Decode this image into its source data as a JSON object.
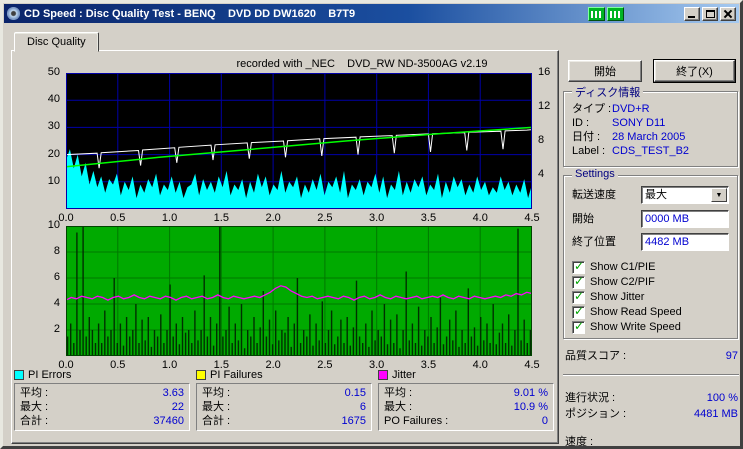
{
  "window": {
    "title": "CD Speed : Disc Quality Test - BENQ    DVD DD DW1620    B7T9"
  },
  "tab": {
    "label": "Disc Quality"
  },
  "chart_data": [
    {
      "type": "area",
      "title": "PI Errors / Read & Write Speed",
      "annotation": "recorded with _NEC    DVD_RW ND-3500AG v2.19",
      "xlabel": "",
      "ylabel": "",
      "x_range": [
        0,
        4.5
      ],
      "x_ticks": [
        "0.0",
        "0.5",
        "1.0",
        "1.5",
        "2.0",
        "2.5",
        "3.0",
        "3.5",
        "4.0",
        "4.5"
      ],
      "y_left": {
        "range": [
          0,
          50
        ],
        "ticks": [
          50,
          40,
          30,
          20,
          10
        ]
      },
      "y_right": {
        "range": [
          0,
          16
        ],
        "ticks": [
          16,
          12,
          8,
          4
        ]
      },
      "bg": "#000000",
      "grid": "#0000a8",
      "frame": "#0000a8",
      "series": [
        {
          "name": "PI Errors",
          "color": "#00ffff",
          "style": "area",
          "axis": "left",
          "values": [
            18,
            22,
            15,
            20,
            12,
            17,
            9,
            14,
            8,
            12,
            6,
            11,
            9,
            13,
            5,
            10,
            7,
            12,
            4,
            9,
            6,
            11,
            8,
            13,
            5,
            9,
            7,
            12,
            6,
            10,
            4,
            8,
            9,
            13,
            5,
            11,
            7,
            10,
            6,
            12,
            8,
            14,
            5,
            9,
            7,
            11,
            4,
            10,
            6,
            13,
            8,
            12,
            5,
            9,
            7,
            14,
            6,
            10,
            8,
            12,
            4,
            9,
            6,
            11,
            7,
            13,
            5,
            10,
            8,
            12,
            6,
            14,
            4,
            9,
            7,
            11,
            5,
            10,
            8,
            13,
            6,
            12,
            4,
            9,
            7,
            14,
            5,
            10,
            6,
            11,
            8,
            12,
            5,
            9,
            7,
            13,
            4,
            10,
            6,
            12,
            8,
            11,
            5,
            9,
            6,
            12,
            7,
            10,
            5,
            8,
            6,
            12,
            7,
            10,
            5,
            9,
            6,
            11,
            4,
            9
          ]
        },
        {
          "name": "Read Speed",
          "color": "#ffffff",
          "style": "line",
          "width": 1,
          "points": [
            [
              0,
              20
            ],
            [
              0.3,
              20.5
            ],
            [
              0.32,
              15
            ],
            [
              0.34,
              20.7
            ],
            [
              0.7,
              21.5
            ],
            [
              0.72,
              16
            ],
            [
              0.74,
              21.7
            ],
            [
              1.05,
              22.5
            ],
            [
              1.07,
              17
            ],
            [
              1.09,
              22.7
            ],
            [
              1.4,
              23.5
            ],
            [
              1.42,
              18
            ],
            [
              1.44,
              23.6
            ],
            [
              1.75,
              24.3
            ],
            [
              1.77,
              18.5
            ],
            [
              1.79,
              24.4
            ],
            [
              2.1,
              25
            ],
            [
              2.12,
              19
            ],
            [
              2.14,
              25.1
            ],
            [
              2.45,
              25.8
            ],
            [
              2.47,
              19.5
            ],
            [
              2.49,
              25.9
            ],
            [
              2.8,
              26.4
            ],
            [
              2.82,
              20
            ],
            [
              2.84,
              26.5
            ],
            [
              3.15,
              27
            ],
            [
              3.17,
              20.5
            ],
            [
              3.19,
              27.1
            ],
            [
              3.5,
              27.6
            ],
            [
              3.52,
              21
            ],
            [
              3.54,
              27.7
            ],
            [
              3.85,
              28.1
            ],
            [
              3.87,
              21.5
            ],
            [
              3.89,
              28.2
            ],
            [
              4.2,
              28.6
            ],
            [
              4.22,
              22
            ],
            [
              4.24,
              28.7
            ],
            [
              4.45,
              29
            ],
            [
              4.5,
              29.2
            ]
          ]
        },
        {
          "name": "Write Speed",
          "color": "#00ff00",
          "style": "line",
          "width": 1.5,
          "points": [
            [
              0,
              15.5
            ],
            [
              0.9,
              19
            ],
            [
              1.8,
              22
            ],
            [
              2.7,
              25
            ],
            [
              3.6,
              27.7
            ],
            [
              4.5,
              30
            ]
          ]
        }
      ]
    },
    {
      "type": "bar",
      "title": "PI Failures / Jitter",
      "xlabel": "",
      "ylabel": "",
      "x_range": [
        0,
        4.5
      ],
      "x_ticks": [
        "0.0",
        "0.5",
        "1.0",
        "1.5",
        "2.0",
        "2.5",
        "3.0",
        "3.5",
        "4.0",
        "4.5"
      ],
      "y_left": {
        "range": [
          0,
          10
        ],
        "ticks": [
          10,
          8,
          6,
          4,
          2
        ]
      },
      "bg": "#00aa00",
      "grid": "#007800",
      "frame": "#004400",
      "series": [
        {
          "name": "PI Failures",
          "color": "#003000",
          "style": "spike",
          "values": [
            1.5,
            2.5,
            1,
            9.5,
            2,
            10,
            1.5,
            3,
            2,
            1,
            2.5,
            1,
            3.5,
            1.5,
            2,
            6,
            1,
            2.5,
            0.8,
            3,
            1.5,
            2,
            4,
            1,
            2.8,
            1.2,
            3,
            0.7,
            2,
            1.5,
            3.2,
            1,
            2,
            5.5,
            1.5,
            2.5,
            0.9,
            3,
            1.8,
            2,
            1,
            3.5,
            1.2,
            2,
            6.2,
            1.5,
            3,
            0.8,
            2.5,
            10,
            1.5,
            2,
            3.8,
            1,
            2.5,
            1.2,
            4,
            0.6,
            2,
            1.5,
            3,
            1,
            2.2,
            5,
            1.5,
            2.8,
            0.9,
            3.5,
            1.2,
            2,
            1.8,
            3,
            0.7,
            2.5,
            6,
            1,
            2,
            1.5,
            3.2,
            0.8,
            2.5,
            1.2,
            4.2,
            1,
            2,
            3.5,
            0.9,
            1.5,
            2.8,
            1,
            3,
            0.8,
            2.2,
            5.8,
            1.5,
            1,
            2.5,
            0.7,
            3.5,
            1.2,
            2,
            1.5,
            4,
            0.9,
            2.8,
            1,
            3.2,
            0.6,
            2,
            6.5,
            1.2,
            2.5,
            1,
            3.8,
            0.8,
            2,
            1.5,
            3,
            1,
            2.2,
            4.5,
            0.9,
            1.5,
            2.8,
            1.2,
            3.5,
            0.7,
            2,
            1,
            5.2,
            1.5,
            2.2,
            0.8,
            3,
            1.2,
            2.5,
            1,
            4,
            0.9,
            1.8,
            2.5,
            1,
            3.2,
            0.8,
            2,
            9.8,
            1.2,
            2.8,
            1,
            2
          ]
        },
        {
          "name": "Jitter",
          "color": "#ff00ff",
          "style": "line-sampled",
          "width": 1.3,
          "values": [
            4.3,
            4.5,
            4.4,
            4.6,
            4.5,
            4.4,
            4.6,
            4.5,
            4.3,
            4.5,
            4.6,
            4.4,
            4.5,
            4.7,
            4.5,
            4.4,
            4.6,
            4.5,
            4.4,
            4.6,
            4.5,
            4.3,
            4.5,
            4.6,
            4.4,
            4.5,
            4.6,
            4.4,
            4.5,
            4.7,
            4.5,
            4.4,
            4.6,
            4.5,
            4.4,
            4.5,
            4.6,
            4.5,
            4.7,
            4.9,
            5.2,
            5.4,
            5.3,
            5.0,
            4.8,
            4.6,
            4.5,
            4.6,
            4.4,
            4.5,
            4.6,
            4.5,
            4.4,
            4.6,
            4.5,
            4.3,
            4.5,
            4.6,
            4.4,
            4.5,
            4.7,
            4.5,
            4.4,
            4.6,
            4.5,
            4.4,
            4.5,
            4.6,
            4.4,
            4.5,
            4.6,
            4.5,
            4.7,
            4.5,
            4.4,
            4.6,
            4.5,
            4.4,
            4.6,
            4.5,
            4.4,
            4.5,
            4.6,
            4.5,
            4.7,
            4.6,
            4.8,
            4.7,
            4.9,
            4.8
          ]
        }
      ]
    }
  ],
  "legend": [
    {
      "name": "PI Errors",
      "swatch": "#00ffff",
      "rows": [
        {
          "label": "平均 :",
          "value": "3.63"
        },
        {
          "label": "最大 :",
          "value": "22"
        },
        {
          "label": "合計 :",
          "value": "37460"
        }
      ]
    },
    {
      "name": "PI Failures",
      "swatch": "#ffff00",
      "rows": [
        {
          "label": "平均 :",
          "value": "0.15"
        },
        {
          "label": "最大 :",
          "value": "6"
        },
        {
          "label": "合計 :",
          "value": "1675"
        }
      ]
    },
    {
      "name": "Jitter",
      "swatch": "#ff00ff",
      "rows": [
        {
          "label": "平均 :",
          "value": "9.01 %"
        },
        {
          "label": "最大 :",
          "value": "10.9 %"
        },
        {
          "label": "PO Failures :",
          "value": "0"
        }
      ]
    }
  ],
  "actions": {
    "start": "開始",
    "exit": "終了(X)"
  },
  "disc_info": {
    "title": "ディスク情報",
    "rows": [
      {
        "label": "タイプ :",
        "value": "DVD+R"
      },
      {
        "label": "ID :",
        "value": "SONY D11"
      },
      {
        "label": "日付 :",
        "value": "28 March 2005"
      },
      {
        "label": "Label :",
        "value": "CDS_TEST_B2"
      }
    ]
  },
  "settings": {
    "title": "Settings",
    "transfer_label": "転送速度",
    "transfer_value": "最大",
    "start_label": "開始",
    "start_value": "0000 MB",
    "end_label": "終了位置",
    "end_value": "4482 MB",
    "checkboxes": [
      {
        "label": "Show C1/PIE",
        "checked": true
      },
      {
        "label": "Show C2/PIF",
        "checked": true
      },
      {
        "label": "Show Jitter",
        "checked": true
      },
      {
        "label": "Show Read Speed",
        "checked": true
      },
      {
        "label": "Show Write Speed",
        "checked": true
      }
    ]
  },
  "status": {
    "score_label": "品質スコア :",
    "score_value": "97",
    "progress_label": "進行状況 :",
    "progress_value": "100 %",
    "position_label": "ポジション :",
    "position_value": "4481 MB",
    "speed_label": "速度 :",
    "speed_value": ""
  }
}
